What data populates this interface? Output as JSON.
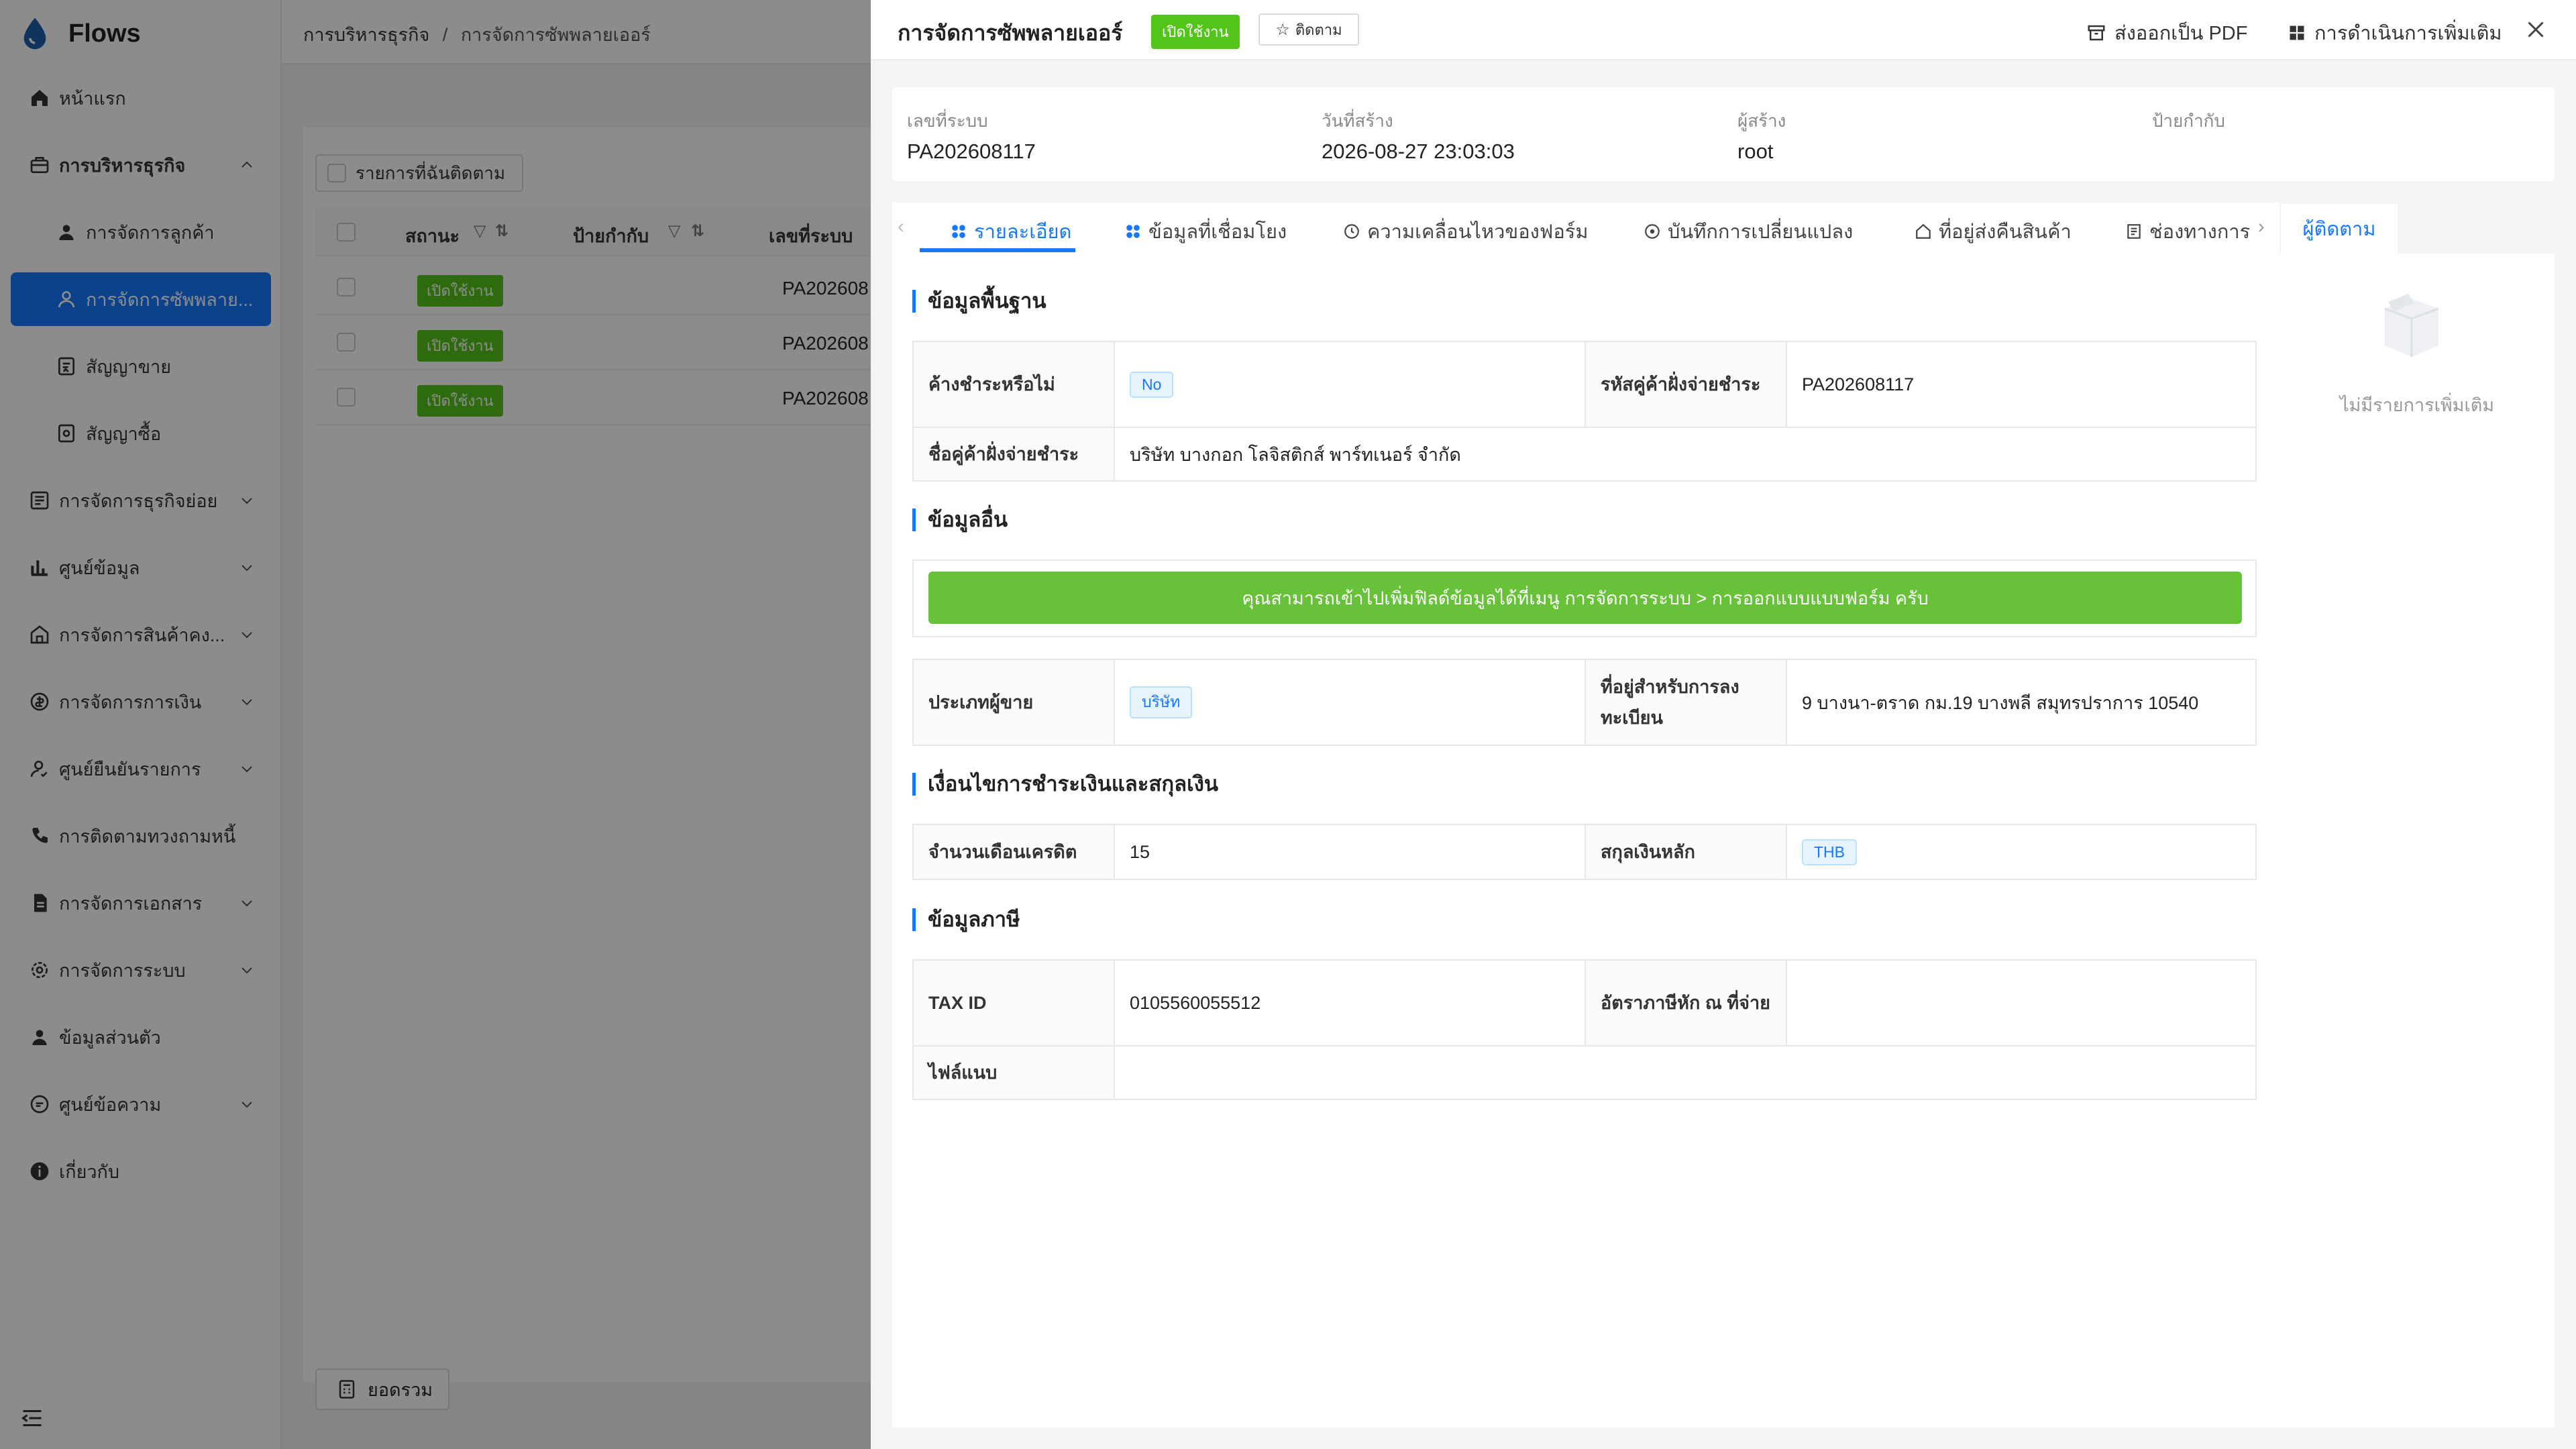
{
  "app": {
    "name": "Flows"
  },
  "sidebar": {
    "items": [
      {
        "label": "หน้าแรก",
        "icon": "home-icon"
      },
      {
        "label": "การบริหารธุรกิจ",
        "icon": "business-icon"
      },
      {
        "label": "การจัดการลูกค้า",
        "icon": "user-icon"
      },
      {
        "label": "การจัดการซัพพลาย...",
        "icon": "supplier-icon"
      },
      {
        "label": "สัญญาขาย",
        "icon": "contract-icon"
      },
      {
        "label": "สัญญาซื้อ",
        "icon": "purchase-contract-icon"
      },
      {
        "label": "การจัดการธุรกิจย่อย",
        "icon": "subbusiness-icon"
      },
      {
        "label": "ศูนย์ข้อมูล",
        "icon": "chart-icon"
      },
      {
        "label": "การจัดการสินค้าคง...",
        "icon": "warehouse-icon"
      },
      {
        "label": "การจัดการการเงิน",
        "icon": "finance-icon"
      },
      {
        "label": "ศูนย์ยืนยันรายการ",
        "icon": "approval-icon"
      },
      {
        "label": "การติดตามทวงถามหนี้",
        "icon": "phone-icon"
      },
      {
        "label": "การจัดการเอกสาร",
        "icon": "document-icon"
      },
      {
        "label": "การจัดการระบบ",
        "icon": "settings-icon"
      },
      {
        "label": "ข้อมูลส่วนตัว",
        "icon": "profile-icon"
      },
      {
        "label": "ศูนย์ข้อความ",
        "icon": "message-icon"
      },
      {
        "label": "เกี่ยวกับ",
        "icon": "info-icon"
      }
    ]
  },
  "breadcrumb": {
    "parent": "การบริหารธุรกิจ",
    "separator": "/",
    "current": "การจัดการซัพพลายเออร์"
  },
  "list": {
    "follow_button": "รายการที่ฉันติดตาม",
    "columns": [
      "สถานะ",
      "ป้ายกำกับ",
      "เลขที่ระบบ"
    ],
    "rows": [
      {
        "status": "เปิดใช้งาน",
        "id": "PA202608"
      },
      {
        "status": "เปิดใช้งาน",
        "id": "PA202608"
      },
      {
        "status": "เปิดใช้งาน",
        "id": "PA202608"
      }
    ],
    "summary_button": "ยอดรวม"
  },
  "drawer": {
    "title": "การจัดการซัพพลายเออร์",
    "status_badge": "เปิดใช้งาน",
    "follow_label": "ติดตาม",
    "export_pdf": "ส่งออกเป็น PDF",
    "more_actions": "การดำเนินการเพิ่มเติม",
    "meta": {
      "system_no_label": "เลขที่ระบบ",
      "system_no": "PA202608117",
      "created_label": "วันที่สร้าง",
      "created": "2026-08-27 23:03:03",
      "creator_label": "ผู้สร้าง",
      "creator": "root",
      "tag_label": "ป้ายกำกับ"
    },
    "tabs": [
      "รายละเอียด",
      "ข้อมูลที่เชื่อมโยง",
      "ความเคลื่อนไหวของฟอร์ม",
      "บันทึกการเปลี่ยนแปลง",
      "ที่อยู่ส่งคืนสินค้า",
      "ช่องทางการ"
    ],
    "follower_tab": "ผู้ติดตาม",
    "follower_empty": "ไม่มีรายการเพิ่มเติม",
    "sections": {
      "basic": "ข้อมูลพื้นฐาน",
      "other": "ข้อมูลอื่น",
      "payment": "เงื่อนไขการชำระเงินและสกุลเงิน",
      "tax": "ข้อมูลภาษี"
    },
    "basic": {
      "outstanding_label": "ค้างชำระหรือไม่",
      "outstanding": "No",
      "payee_code_label": "รหัสคู่ค้าฝั่งจ่ายชำระ",
      "payee_code": "PA202608117",
      "payee_name_label": "ชื่อคู่ค้าฝั่งจ่ายชำระ",
      "payee_name": "บริษัท บางกอก โลจิสติกส์ พาร์ทเนอร์ จำกัด"
    },
    "other_notice": "คุณสามารถเข้าไปเพิ่มฟิลด์ข้อมูลได้ที่เมนู การจัดการระบบ > การออกแบบแบบฟอร์ม ครับ",
    "other": {
      "seller_type_label": "ประเภทผู้ขาย",
      "seller_type": "บริษัท",
      "reg_address_label": "ที่อยู่สำหรับการลงทะเบียน",
      "reg_address": "9 บางนา-ตราด กม.19 บางพลี สมุทรปราการ 10540"
    },
    "payment": {
      "credit_months_label": "จำนวนเดือนเครดิต",
      "credit_months": "15",
      "currency_label": "สกุลเงินหลัก",
      "currency": "THB"
    },
    "tax": {
      "tax_id_label": "TAX ID",
      "tax_id": "0105560055512",
      "wht_label": "อัตราภาษีหัก ณ ที่จ่าย",
      "wht": "",
      "attachment_label": "ไฟล์แนบ",
      "attachment": ""
    }
  },
  "colors": {
    "primary": "#1677ff",
    "success": "#52c41a",
    "notice": "#67c23a"
  }
}
